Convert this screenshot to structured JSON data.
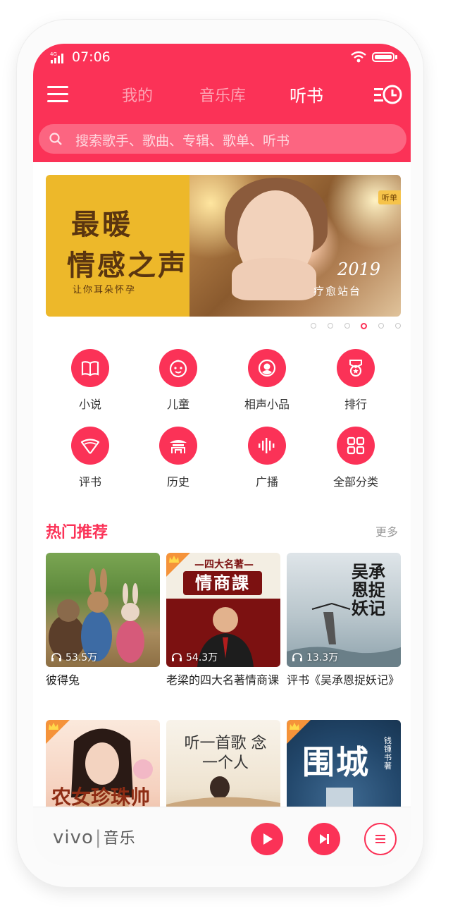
{
  "status_bar": {
    "time": "07:06",
    "signal_label": "4G"
  },
  "nav": {
    "tabs": [
      {
        "label": "我的",
        "active": false
      },
      {
        "label": "音乐库",
        "active": false
      },
      {
        "label": "听书",
        "active": true
      }
    ]
  },
  "search": {
    "placeholder": "搜索歌手、歌曲、专辑、歌单、听书"
  },
  "banner": {
    "title_line1": "最暖",
    "title_line2": "情感之声",
    "subtitle": "让你耳朵怀孕",
    "year": "2019",
    "slogan": "疗愈站台",
    "tag": "听单",
    "dots_total": 6,
    "dots_active_index": 3
  },
  "categories": [
    {
      "label": "小说",
      "icon": "book-icon"
    },
    {
      "label": "儿童",
      "icon": "child-face-icon"
    },
    {
      "label": "相声小品",
      "icon": "comedy-mask-icon"
    },
    {
      "label": "排行",
      "icon": "medal-icon"
    },
    {
      "label": "评书",
      "icon": "fan-icon"
    },
    {
      "label": "历史",
      "icon": "temple-icon"
    },
    {
      "label": "广播",
      "icon": "radio-wave-icon"
    },
    {
      "label": "全部分类",
      "icon": "grid-icon"
    }
  ],
  "recommend": {
    "title": "热门推荐",
    "more": "更多",
    "items": [
      {
        "title": "彼得兔",
        "plays": "53.5万",
        "vip": false
      },
      {
        "title": "老梁的四大名著情商课",
        "plays": "54.3万",
        "vip": true,
        "cover_banner": "—四大名著—",
        "cover_title": "情商課"
      },
      {
        "title": "评书《吴承恩捉妖记》",
        "plays": "13.3万",
        "vip": false,
        "cover_title": "吴承恩捉妖记"
      },
      {
        "title": "",
        "plays": "",
        "vip": true,
        "cover_title": "农女珍珠帅"
      },
      {
        "title": "",
        "plays": "",
        "vip": false,
        "cover_title": "听一首歌 念一个人"
      },
      {
        "title": "",
        "plays": "",
        "vip": true,
        "cover_title": "围城",
        "cover_author": "钱锺书著"
      }
    ]
  },
  "player_bar": {
    "brand": "vivo",
    "brand_cn": "音乐"
  },
  "colors": {
    "accent": "#fb3257",
    "banner_yellow": "#edb82a",
    "vip_orange": "#f5933a"
  }
}
